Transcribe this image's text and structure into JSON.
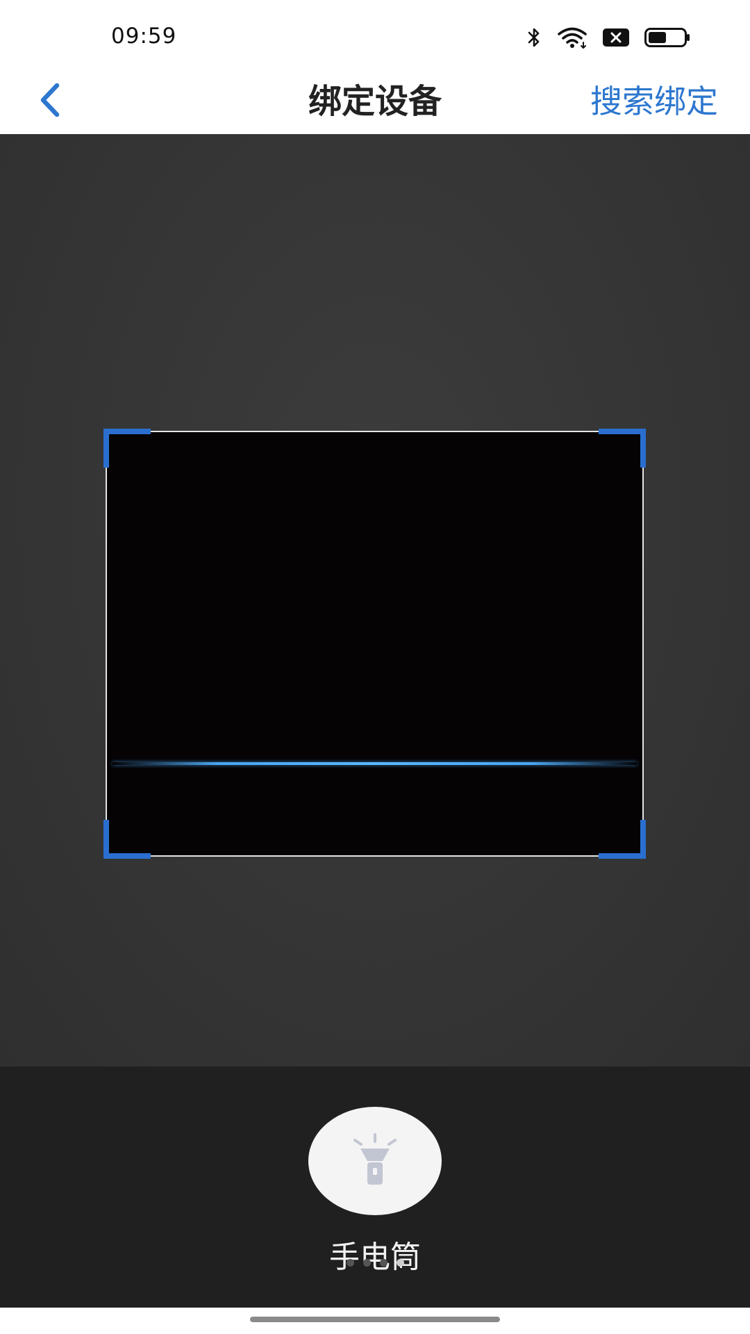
{
  "status_bar": {
    "time": "09:59",
    "icons": [
      "bluetooth-icon",
      "wifi-icon",
      "sim-off-icon",
      "battery-icon"
    ],
    "battery_level": 0.5
  },
  "nav": {
    "back_icon": "chevron-left-icon",
    "title": "绑定设备",
    "action_label": "搜索绑定"
  },
  "scanner": {
    "frame_accent_color": "#2a6fd0",
    "scan_line_color": "#4aa6f0"
  },
  "torch": {
    "icon": "flashlight-icon",
    "label": "手电筒"
  },
  "pager": {
    "count": 4,
    "active_index": 3
  },
  "colors": {
    "accent": "#2d77cf",
    "camera_background": "#363636",
    "bottom_panel": "#202020"
  }
}
